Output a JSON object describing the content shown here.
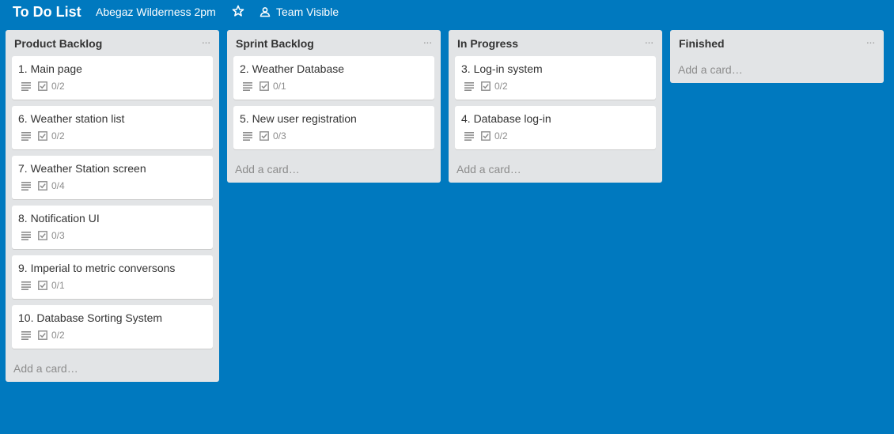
{
  "header": {
    "board_title": "To Do List",
    "team_name": "Abegaz Wilderness 2pm",
    "star_icon": "star-icon",
    "visibility_label": "Team Visible",
    "visibility_icon": "team-icon"
  },
  "colors": {
    "board_background": "#0079bf",
    "list_background": "#e2e4e6",
    "card_background": "#ffffff"
  },
  "lists": [
    {
      "title": "Product Backlog",
      "menu_label": "···",
      "add_card_label": "Add a card…",
      "cards": [
        {
          "title": "1. Main page",
          "checklist": "0/2"
        },
        {
          "title": "6. Weather station list",
          "checklist": "0/2"
        },
        {
          "title": "7. Weather Station screen",
          "checklist": "0/4"
        },
        {
          "title": "8. Notification UI",
          "checklist": "0/3"
        },
        {
          "title": "9. Imperial to metric conversons",
          "checklist": "0/1"
        },
        {
          "title": "10. Database Sorting System",
          "checklist": "0/2"
        }
      ]
    },
    {
      "title": "Sprint Backlog",
      "menu_label": "···",
      "add_card_label": "Add a card…",
      "cards": [
        {
          "title": "2. Weather Database",
          "checklist": "0/1"
        },
        {
          "title": "5. New user registration",
          "checklist": "0/3"
        }
      ]
    },
    {
      "title": "In Progress",
      "menu_label": "···",
      "add_card_label": "Add a card…",
      "cards": [
        {
          "title": "3. Log-in system",
          "checklist": "0/2"
        },
        {
          "title": "4. Database log-in",
          "checklist": "0/2"
        }
      ]
    },
    {
      "title": "Finished",
      "menu_label": "···",
      "add_card_label": "Add a card…",
      "cards": []
    }
  ]
}
